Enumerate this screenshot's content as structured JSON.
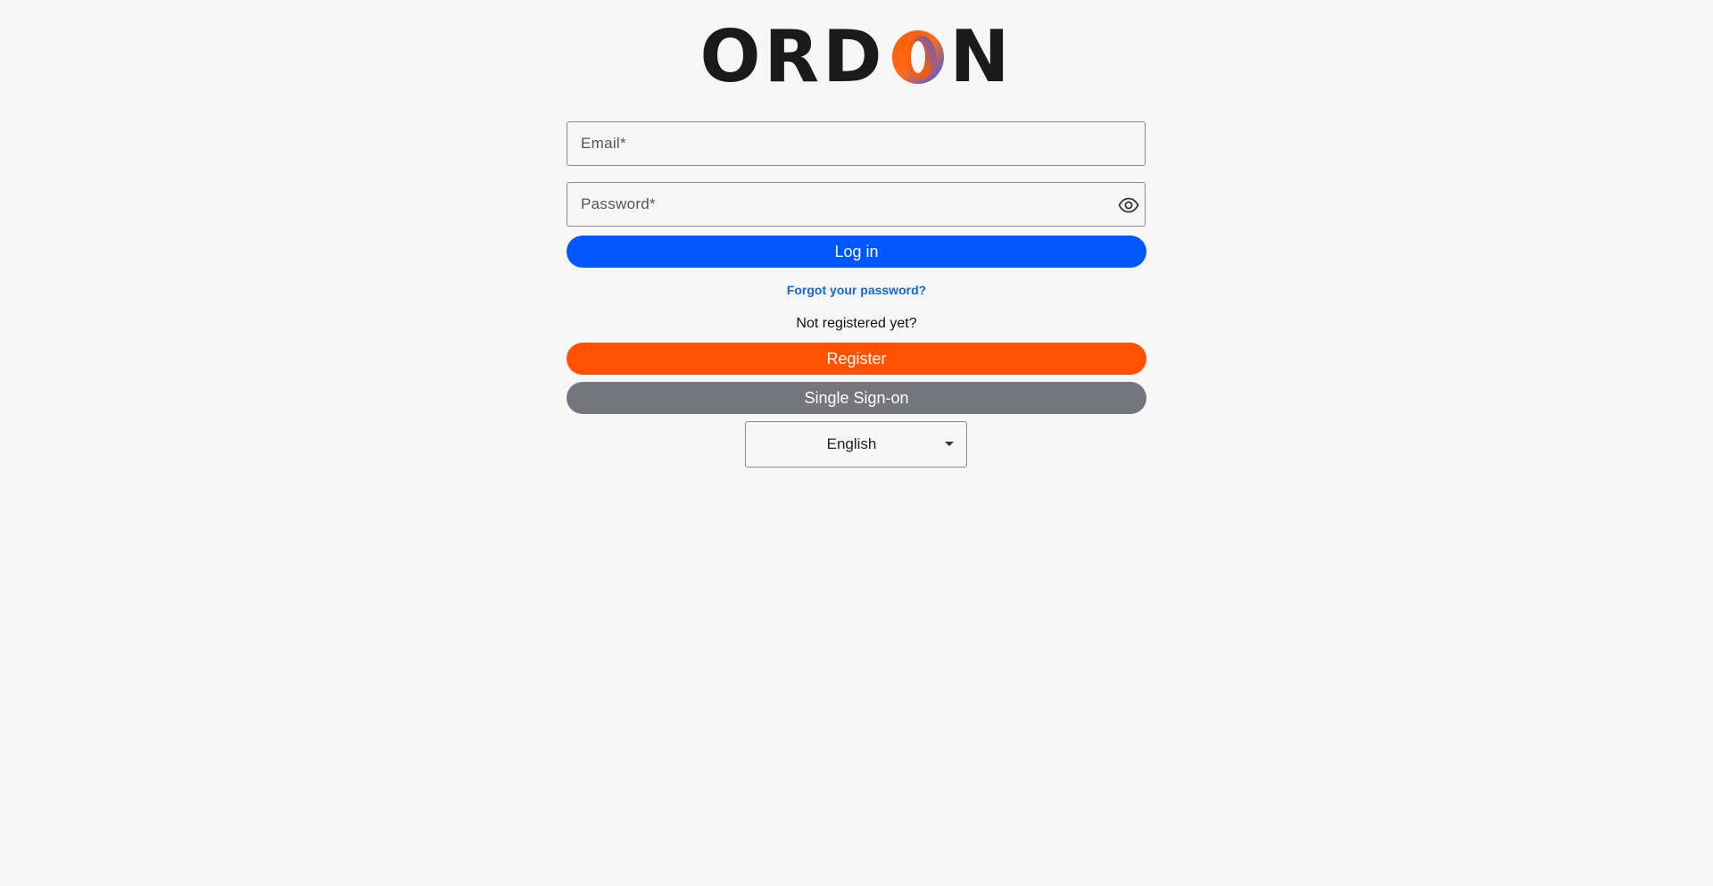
{
  "brand": {
    "logo_text_left": "ORD",
    "logo_text_right": "N",
    "logo_accent_colors": [
      "#ff5200",
      "#2f5bff"
    ]
  },
  "form": {
    "email_placeholder": "Email*",
    "password_placeholder": "Password*",
    "login_label": "Log in",
    "forgot_label": "Forgot your password?",
    "not_registered_text": "Not registered yet?",
    "register_label": "Register",
    "sso_label": "Single Sign-on"
  },
  "language": {
    "selected": "English"
  },
  "colors": {
    "primary": "#0057ff",
    "register": "#ff5200",
    "sso": "#74757d",
    "link": "#1565d8",
    "background": "#f6f6f6"
  }
}
